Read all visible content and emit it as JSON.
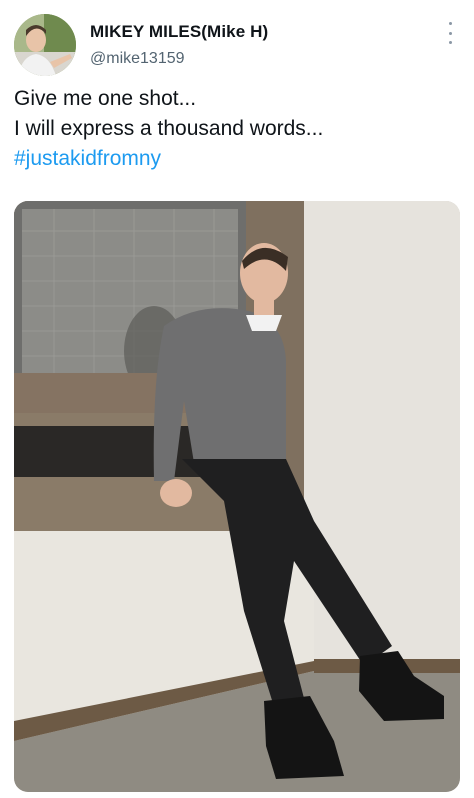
{
  "author": {
    "display_name": "MIKEY MILES(Mike H)",
    "handle": "@mike13159",
    "avatar_icon": "profile-photo"
  },
  "menu": {
    "icon": "more-vertical-icon"
  },
  "tweet": {
    "line1": "Give me one shot...",
    "line2": "I will express a thousand words...",
    "hashtag": "#justakidfromny"
  },
  "media": {
    "icon": "photo"
  },
  "colors": {
    "text": "#0f1419",
    "secondary": "#536471",
    "link": "#1d9bf0"
  }
}
